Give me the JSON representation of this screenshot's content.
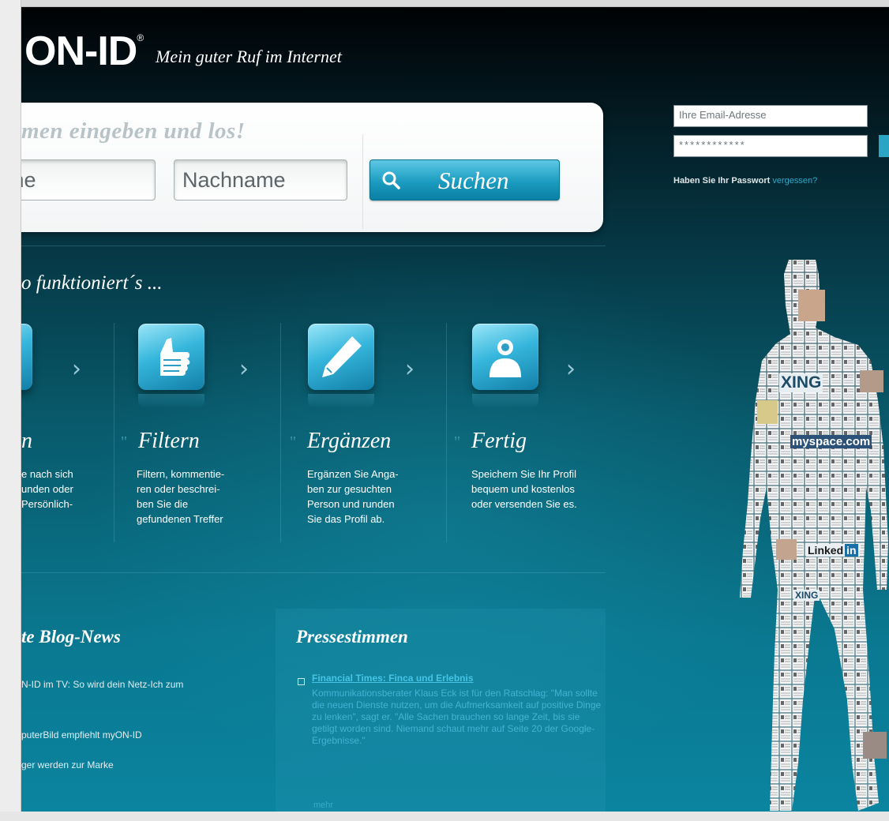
{
  "header": {
    "logo": "ON-ID",
    "logo_mark": "®",
    "tagline": "Mein guter Ruf im Internet"
  },
  "search": {
    "heading": "men eingeben und los!",
    "first_name_placeholder": "name",
    "last_name_placeholder": "Nachname",
    "button_label": "Suchen"
  },
  "login": {
    "email_placeholder": "Ihre Email-Adresse",
    "password_value": "************",
    "forgot_text": "Haben Sie Ihr Passwort",
    "forgot_link": "vergessen?"
  },
  "how": {
    "title": "o funktioniert´s ...",
    "steps": [
      {
        "title": "n",
        "text": "e nach sich\nunden oder\nPersönlich-"
      },
      {
        "title": "Filtern",
        "text": "Filtern, kommentie-\nren oder beschrei-\nben Sie die\ngefundenen Treffer"
      },
      {
        "title": "Ergänzen",
        "text": "Ergänzen Sie Anga-\nben zur gesuchten\nPerson und runden\nSie das Profil ab."
      },
      {
        "title": "Fertig",
        "text": "Speichern Sie Ihr Profil\nbequem und kostenlos\noder versenden Sie es."
      }
    ],
    "quote_mark": "\"",
    "arrow": "›"
  },
  "news": {
    "title": "te Blog-News",
    "items": [
      "N-ID im TV: So wird dein Netz-Ich zum",
      "puterBild empfiehlt myON-ID",
      "ger werden zur Marke"
    ]
  },
  "press": {
    "title": "Pressestimmen",
    "link": "Financial Times: Finca und Erlebnis",
    "body": "Kommunikationsberater Klaus Eck ist für den Ratschlag: \"Man sollte die neuen Dienste nutzen, um die Aufmerksamkeit auf positive Dinge zu lenken\", sagt er. \"Alle Sachen brauchen so lange Zeit, bis sie getilgt worden sind. Niemand schaut mehr auf Seite 20 der Google-Ergebnisse.\"",
    "more": "mehr"
  },
  "figure": {
    "brands": [
      "XING",
      "myspace.com",
      "Linked",
      "in",
      "XING"
    ]
  },
  "colors": {
    "accent": "#1b9cc0",
    "link": "#2fa9c8",
    "background_dark": "#021218",
    "background_teal": "#0b84a0"
  }
}
